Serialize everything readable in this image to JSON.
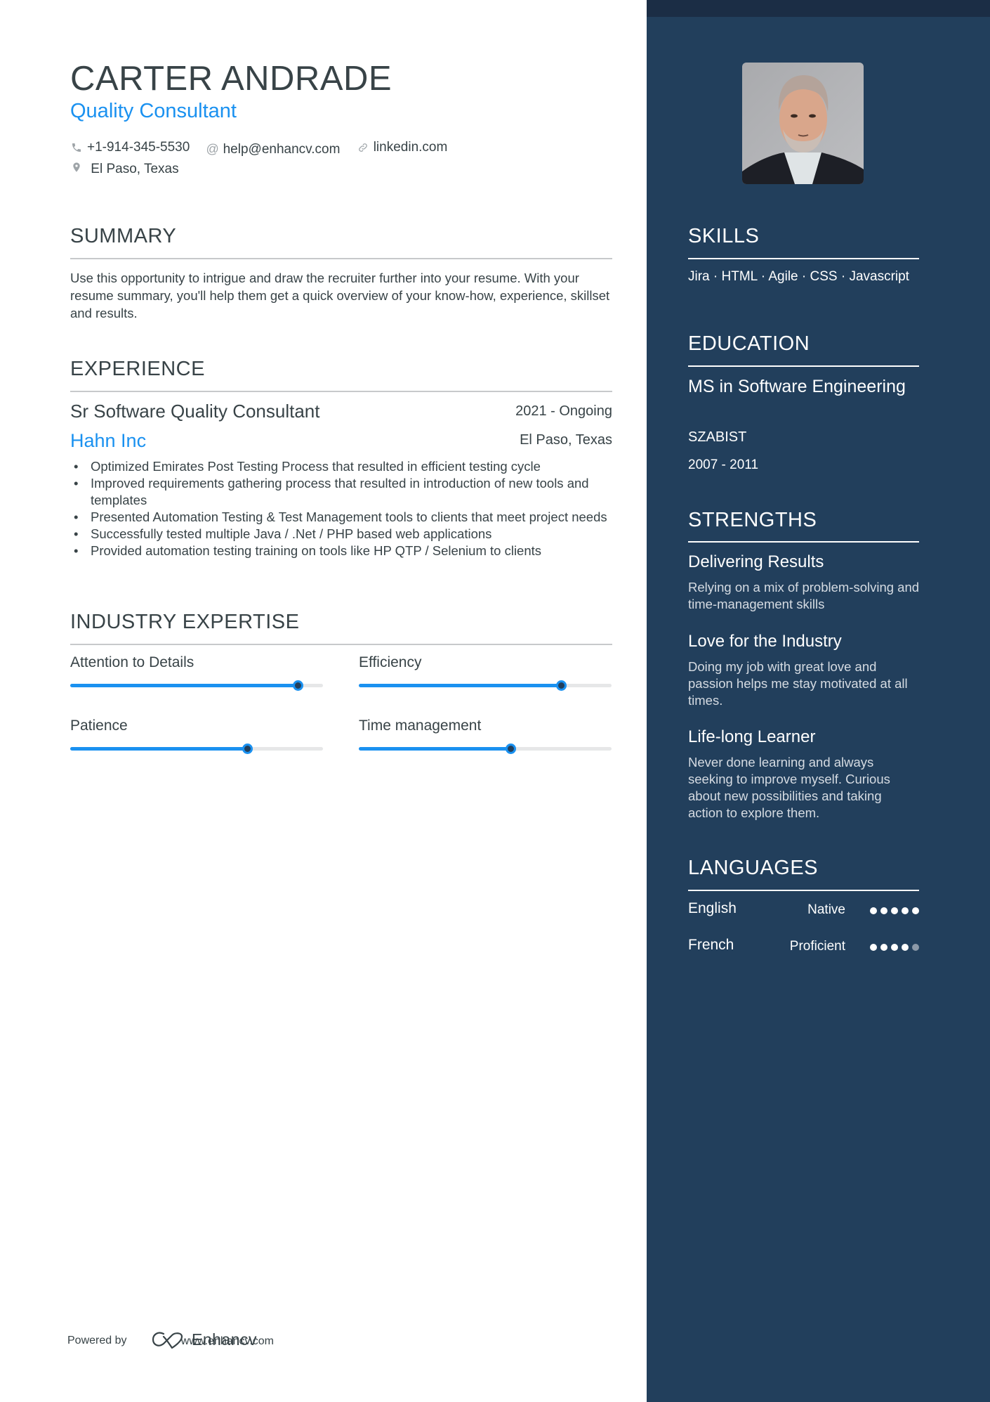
{
  "header": {
    "name": "CARTER ANDRADE",
    "role": "Quality Consultant",
    "phone": "+1-914-345-5530",
    "email": "help@enhancv.com",
    "link": "linkedin.com",
    "location": "El Paso, Texas"
  },
  "summary": {
    "title": "SUMMARY",
    "text": "Use this opportunity to intrigue and draw the recruiter further into your resume. With your resume summary, you'll help them get a quick overview of your know-how, experience, skillset and results."
  },
  "experience": {
    "title": "EXPERIENCE",
    "jobs": [
      {
        "title": "Sr Software Quality Consultant",
        "dates": "2021 - Ongoing",
        "company": "Hahn Inc",
        "location": "El Paso, Texas",
        "bullets": [
          "Optimized Emirates Post Testing Process that resulted in efficient testing cycle",
          " Improved requirements gathering process that resulted in introduction of new tools and templates",
          " Presented Automation Testing & Test Management tools to clients that meet project needs",
          " Successfully tested multiple Java / .Net / PHP  based web applications",
          " Provided automation testing training on tools like HP QTP / Selenium to clients"
        ]
      }
    ]
  },
  "expertise": {
    "title": "INDUSTRY EXPERTISE",
    "items": [
      {
        "label": "Attention to Details",
        "level_percent": 90
      },
      {
        "label": "Efficiency",
        "level_percent": 80
      },
      {
        "label": "Patience",
        "level_percent": 70
      },
      {
        "label": "Time management",
        "level_percent": 60
      }
    ]
  },
  "skills": {
    "title": "SKILLS",
    "text": "Jira · HTML · Agile · CSS · Javascript"
  },
  "education": {
    "title": "EDUCATION",
    "degree": "MS in Software Engineering",
    "school": "SZABIST",
    "dates": "2007 - 2011"
  },
  "strengths": {
    "title": "STRENGTHS",
    "items": [
      {
        "title": "Delivering Results",
        "desc": "Relying on a mix of problem-solving and time-management skills"
      },
      {
        "title": "Love for the Industry",
        "desc": "Doing my job with great love and passion helps me stay motivated at all times."
      },
      {
        "title": "Life-long Learner",
        "desc": "Never done learning and always seeking to improve myself. Curious about new possibilities and taking action to explore them."
      }
    ]
  },
  "languages": {
    "title": "LANGUAGES",
    "items": [
      {
        "name": "English",
        "level": "Native",
        "dots_filled": 5,
        "dots_total": 5
      },
      {
        "name": "French",
        "level": "Proficient",
        "dots_filled": 4,
        "dots_total": 5
      }
    ]
  },
  "footer": {
    "powered_by": "Powered by",
    "brand": "Enhancv",
    "url": "www.enhancv.com"
  },
  "colors": {
    "accent": "#1a91f0",
    "sidebar": "#223f5c",
    "text": "#384347"
  }
}
